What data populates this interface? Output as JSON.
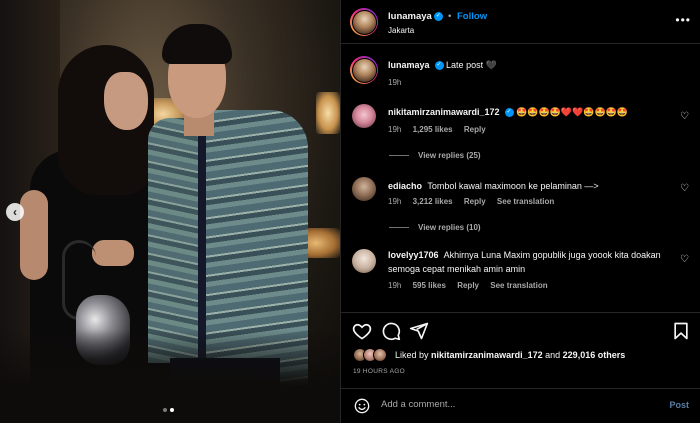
{
  "post": {
    "author": "lunamaya",
    "follow_label": "Follow",
    "separator": "•",
    "location": "Jakarta",
    "more_icon": "more-horizontal-icon",
    "caption": "Late post 🖤",
    "caption_time": "19h"
  },
  "carousel": {
    "prev_icon": "chevron-left-icon",
    "prev_glyph": "‹",
    "current_index": 2,
    "total": 2
  },
  "comments": [
    {
      "username": "nikitamirzanimawardi_172",
      "verified": true,
      "text": "🤩🤩🤩🤩❤️❤️🤩🤩🤩🤩",
      "time": "19h",
      "likes": "1,295 likes",
      "reply_label": "Reply",
      "translation_label": "",
      "view_replies": "View replies (25)"
    },
    {
      "username": "ediacho",
      "verified": false,
      "text": "Tombol kawal maximoon ke pelaminan —>",
      "time": "19h",
      "likes": "3,212 likes",
      "reply_label": "Reply",
      "translation_label": "See translation",
      "view_replies": "View replies (10)"
    },
    {
      "username": "lovelyy1706",
      "verified": false,
      "text": "Akhirnya Luna Maxim gopublik juga yoook kita doakan semoga cepat menikah amin amin",
      "time": "19h",
      "likes": "595 likes",
      "reply_label": "Reply",
      "translation_label": "See translation",
      "view_replies": ""
    }
  ],
  "liked_by": {
    "prefix": "Liked by",
    "user": "nikitamirzanimawardi_172",
    "and": "and",
    "others": "229,016 others"
  },
  "time_ago": "19 HOURS AGO",
  "comment_box": {
    "placeholder": "Add a comment...",
    "post_label": "Post"
  },
  "icons": {
    "like": "heart-icon",
    "comment": "comment-icon",
    "share": "share-icon",
    "save": "bookmark-icon",
    "emoji": "emoji-icon"
  },
  "colors": {
    "link_blue": "#0095f6",
    "muted": "#a8a8a8",
    "background": "#000000"
  }
}
